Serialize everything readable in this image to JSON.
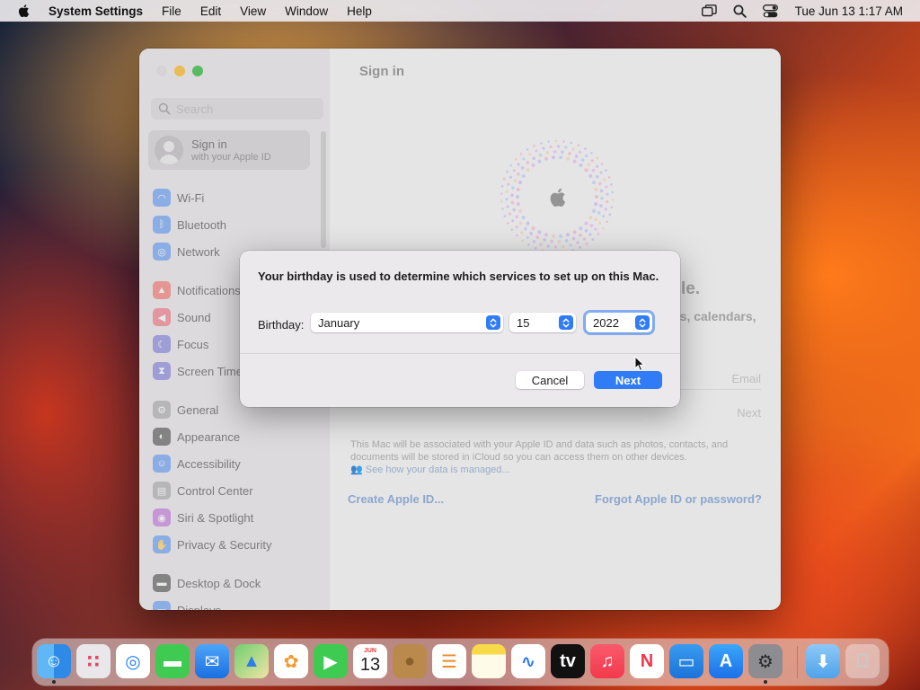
{
  "menubar": {
    "app_name": "System Settings",
    "items": [
      "File",
      "Edit",
      "View",
      "Window",
      "Help"
    ],
    "clock": "Tue Jun 13  1:17 AM",
    "icons": [
      "apple-icon",
      "screen-mirroring-icon",
      "spotlight-search-icon",
      "control-center-icon"
    ]
  },
  "window": {
    "title": "Sign in",
    "search_placeholder": "Search",
    "account": {
      "title": "Sign in",
      "subtitle": "with your Apple ID"
    },
    "sidebar": [
      {
        "label": "Wi-Fi",
        "icon": "wifi-icon",
        "color": "#2f7cf6"
      },
      {
        "label": "Bluetooth",
        "icon": "bluetooth-icon",
        "color": "#2f7cf6"
      },
      {
        "label": "Network",
        "icon": "globe-icon",
        "color": "#2f7cf6"
      },
      {
        "label": "Notifications",
        "icon": "bell-icon",
        "color": "#f04a3e"
      },
      {
        "label": "Sound",
        "icon": "speaker-icon",
        "color": "#f04a5c"
      },
      {
        "label": "Focus",
        "icon": "moon-icon",
        "color": "#5b57d6"
      },
      {
        "label": "Screen Time",
        "icon": "hourglass-icon",
        "color": "#5b57d6"
      },
      {
        "label": "General",
        "icon": "gear-icon",
        "color": "#8e8e93"
      },
      {
        "label": "Appearance",
        "icon": "appearance-icon",
        "color": "#1d1d1d"
      },
      {
        "label": "Accessibility",
        "icon": "accessibility-icon",
        "color": "#2f7cf6"
      },
      {
        "label": "Control Center",
        "icon": "control-center-icon",
        "color": "#8e8e93"
      },
      {
        "label": "Siri & Spotlight",
        "icon": "siri-icon",
        "color": "#b14ad6"
      },
      {
        "label": "Privacy & Security",
        "icon": "hand-icon",
        "color": "#2f7cf6"
      },
      {
        "label": "Desktop & Dock",
        "icon": "dock-icon",
        "color": "#1d1d1d"
      },
      {
        "label": "Displays",
        "icon": "display-icon",
        "color": "#2f7cf6"
      }
    ],
    "content": {
      "partial_heading_end": "le.",
      "partial_line": "ts, calendars,",
      "email_placeholder": "Email",
      "next_label": "Next",
      "legal_text": "This Mac will be associated with your Apple ID and data such as photos, contacts, and documents will be stored in iCloud so you can access them on other devices.",
      "legal_link": "See how your data is managed...",
      "create_link": "Create Apple ID...",
      "forgot_link": "Forgot Apple ID or password?"
    }
  },
  "dialog": {
    "message": "Your birthday is used to determine which services to set up on this Mac.",
    "birthday_label": "Birthday:",
    "month": "January",
    "day": "15",
    "year": "2022",
    "cancel_label": "Cancel",
    "next_label": "Next"
  },
  "dock": {
    "calendar_month": "JUN",
    "calendar_day": "13",
    "apps": [
      "Finder",
      "Launchpad",
      "Safari",
      "Messages",
      "Mail",
      "Maps",
      "Photos",
      "FaceTime",
      "Calendar",
      "Contacts",
      "Reminders",
      "Notes",
      "Freeform",
      "TV",
      "Music",
      "News",
      "Keynote",
      "App Store",
      "System Settings",
      "Downloads",
      "Trash"
    ]
  }
}
